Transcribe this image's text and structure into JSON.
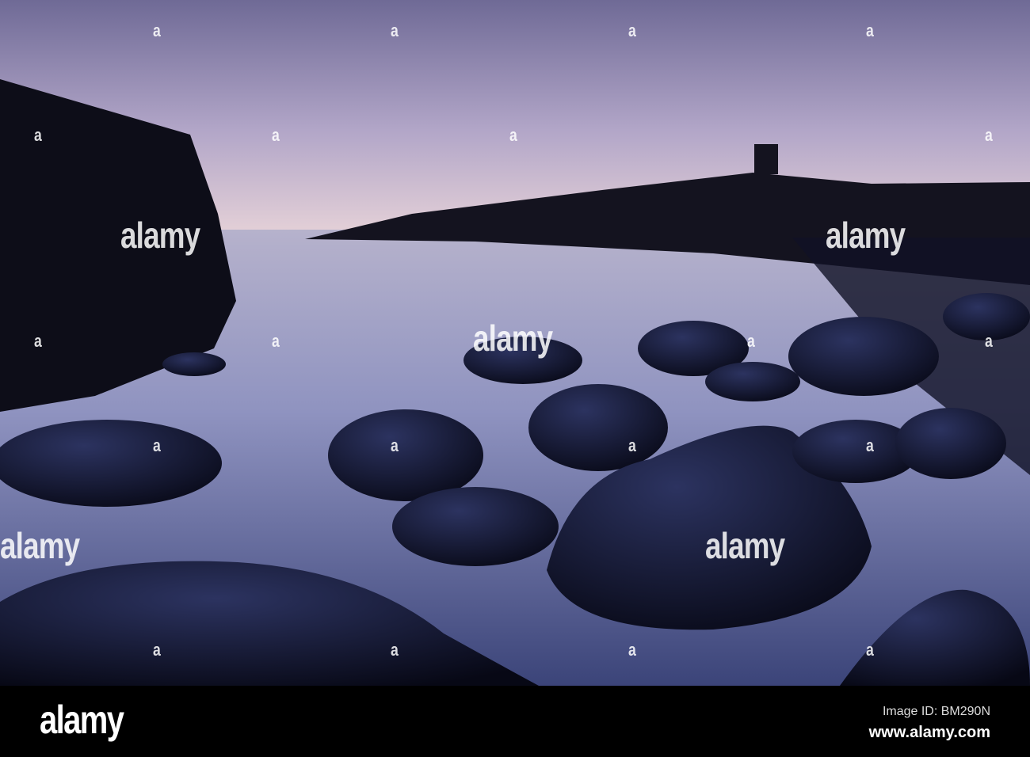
{
  "watermark": {
    "big": "alamy",
    "small": "a"
  },
  "footer": {
    "logo": "alamy",
    "image_id": "Image ID: BM290N",
    "url": "www.alamy.com"
  }
}
